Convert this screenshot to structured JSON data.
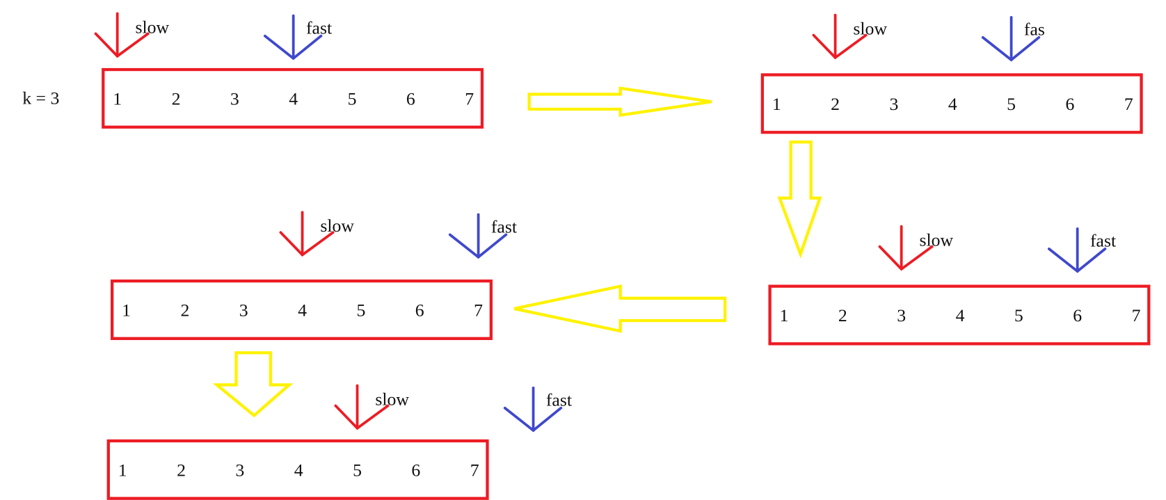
{
  "k_label": "k = 3",
  "colors": {
    "box": "#ed1c24",
    "slow": "#ed1c24",
    "fast": "#3f48cc",
    "flow_arrow": "#fff200"
  },
  "rows": [
    {
      "numbers": [
        "1",
        "2",
        "3",
        "4",
        "5",
        "6",
        "7"
      ],
      "slow": {
        "label": "slow",
        "index": 1
      },
      "fast": {
        "label": "fast",
        "index": 4
      }
    },
    {
      "numbers": [
        "1",
        "2",
        "3",
        "4",
        "5",
        "6",
        "7"
      ],
      "slow": {
        "label": "slow",
        "index": 2
      },
      "fast": {
        "label": "fas",
        "index": 5
      }
    },
    {
      "numbers": [
        "1",
        "2",
        "3",
        "4",
        "5",
        "6",
        "7"
      ],
      "slow": {
        "label": "slow",
        "index": 3
      },
      "fast": {
        "label": "fast",
        "index": 6
      }
    },
    {
      "numbers": [
        "1",
        "2",
        "3",
        "4",
        "5",
        "6",
        "7"
      ],
      "slow": {
        "label": "slow",
        "index": 4
      },
      "fast": {
        "label": "fast",
        "index": 7
      }
    },
    {
      "numbers": [
        "1",
        "2",
        "3",
        "4",
        "5",
        "6",
        "7"
      ],
      "slow": {
        "label": "slow",
        "index": 5
      },
      "fast": {
        "label": "fast",
        "index": 8
      }
    }
  ],
  "flow": [
    "right",
    "down",
    "left",
    "down"
  ]
}
